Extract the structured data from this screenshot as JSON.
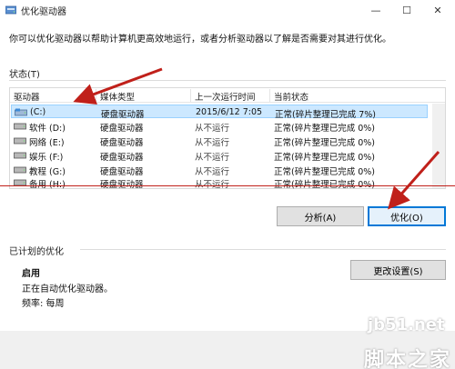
{
  "window": {
    "title": "优化驱动器",
    "minimize": "—",
    "maximize": "☐",
    "close": "✕"
  },
  "description": "你可以优化驱动器以帮助计算机更高效地运行，或者分析驱动器以了解是否需要对其进行优化。",
  "status_section": {
    "label": "状态(T)"
  },
  "table": {
    "columns": [
      "驱动器",
      "媒体类型",
      "上一次运行时间",
      "当前状态"
    ],
    "rows": [
      {
        "drive": "(C:)",
        "media": "硬盘驱动器",
        "last_run": "2015/6/12 7:05",
        "status": "正常(碎片整理已完成 7%)",
        "selected": true
      },
      {
        "drive": "软件 (D:)",
        "media": "硬盘驱动器",
        "last_run": "从不运行",
        "status": "正常(碎片整理已完成 0%)",
        "selected": false
      },
      {
        "drive": "网络 (E:)",
        "media": "硬盘驱动器",
        "last_run": "从不运行",
        "status": "正常(碎片整理已完成 0%)",
        "selected": false
      },
      {
        "drive": "娱乐 (F:)",
        "media": "硬盘驱动器",
        "last_run": "从不运行",
        "status": "正常(碎片整理已完成 0%)",
        "selected": false
      },
      {
        "drive": "教程 (G:)",
        "media": "硬盘驱动器",
        "last_run": "从不运行",
        "status": "正常(碎片整理已完成 0%)",
        "selected": false
      },
      {
        "drive": "备用 (H:)",
        "media": "硬盘驱动器",
        "last_run": "从不运行",
        "status": "正常(碎片整理已完成 0%)",
        "selected": false
      }
    ]
  },
  "buttons": {
    "analyze": "分析(A)",
    "optimize": "优化(O)",
    "change_settings": "更改设置(S)"
  },
  "scheduled": {
    "section_label": "已计划的优化",
    "state": "启用",
    "line1": "正在自动优化驱动器。",
    "line2": "频率: 每周"
  },
  "watermark": {
    "site": "jb51.net",
    "name": "脚本之家"
  },
  "colors": {
    "selection": "#cce8ff",
    "annotation_red": "#c0201a",
    "accent_blue": "#0078d7"
  },
  "icons": [
    "optimize-drives-app-icon",
    "drive-icon"
  ]
}
